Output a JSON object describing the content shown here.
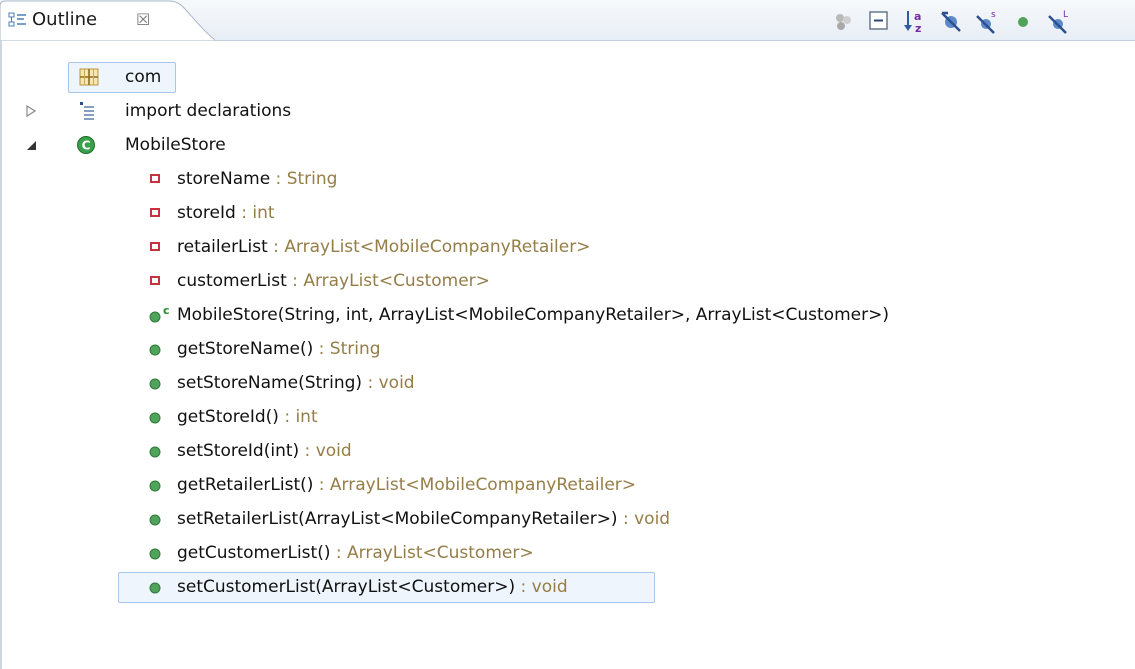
{
  "view": {
    "title": "Outline",
    "close_glyph": "☒"
  },
  "toolbar": {
    "icons": [
      "collapse-icon-disabled",
      "collapse-all-icon",
      "sort-icon",
      "hide-fields-icon",
      "hide-static-icon",
      "hide-non-public-icon",
      "hide-local-types-icon"
    ]
  },
  "tree": {
    "package": {
      "name": "com"
    },
    "imports": {
      "label": "import declarations"
    },
    "class": {
      "name": "MobileStore"
    },
    "members": [
      {
        "kind": "field",
        "name": "storeName",
        "type": " : String"
      },
      {
        "kind": "field",
        "name": "storeId",
        "type": " : int"
      },
      {
        "kind": "field",
        "name": "retailerList",
        "type": " : ArrayList<MobileCompanyRetailer>"
      },
      {
        "kind": "field",
        "name": "customerList",
        "type": " : ArrayList<Customer>"
      },
      {
        "kind": "constructor",
        "name": "MobileStore(String, int, ArrayList<MobileCompanyRetailer>, ArrayList<Customer>)",
        "type": ""
      },
      {
        "kind": "method",
        "name": "getStoreName()",
        "type": " : String"
      },
      {
        "kind": "method",
        "name": "setStoreName(String)",
        "type": " : void"
      },
      {
        "kind": "method",
        "name": "getStoreId()",
        "type": " : int"
      },
      {
        "kind": "method",
        "name": "setStoreId(int)",
        "type": " : void"
      },
      {
        "kind": "method",
        "name": "getRetailerList()",
        "type": " : ArrayList<MobileCompanyRetailer>"
      },
      {
        "kind": "method",
        "name": "setRetailerList(ArrayList<MobileCompanyRetailer>)",
        "type": " : void"
      },
      {
        "kind": "method",
        "name": "getCustomerList()",
        "type": " : ArrayList<Customer>"
      },
      {
        "kind": "method",
        "name": "setCustomerList(ArrayList<Customer>)",
        "type": " : void"
      }
    ]
  },
  "colors": {
    "type_text": "#957d47",
    "field_private": "#c2353d",
    "method_public": "#4fa35a",
    "class_icon": "#3aa14a",
    "selection_border": "#a8c7ea"
  }
}
